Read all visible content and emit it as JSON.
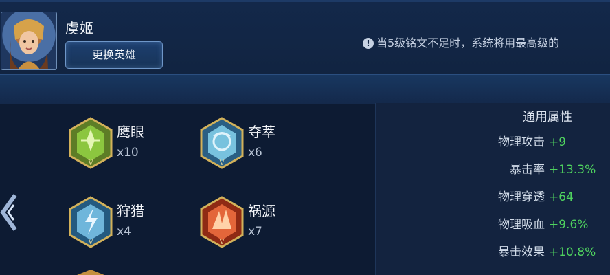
{
  "hero": {
    "name": "虞姬",
    "change_button": "更换英雄",
    "avatar_icon": "hero-portrait"
  },
  "notice": {
    "icon": "!",
    "text": "当5级铭文不足时，系统将用最高级的"
  },
  "runes": [
    {
      "name": "鹰眼",
      "count": "x10",
      "color": "#6fae3a"
    },
    {
      "name": "夺萃",
      "count": "x6",
      "color": "#5aa6c9"
    },
    {
      "name": "狩猎",
      "count": "x4",
      "color": "#4f9fcf"
    },
    {
      "name": "祸源",
      "count": "x7",
      "color": "#d8542c"
    }
  ],
  "stats": {
    "title": "通用属性",
    "rows": [
      {
        "label": "物理攻击",
        "value": "+9"
      },
      {
        "label": "暴击率",
        "value": "+13.3%"
      },
      {
        "label": "物理穿透",
        "value": "+64"
      },
      {
        "label": "物理吸血",
        "value": "+9.6%"
      },
      {
        "label": "暴击效果",
        "value": "+10.8%"
      }
    ]
  }
}
